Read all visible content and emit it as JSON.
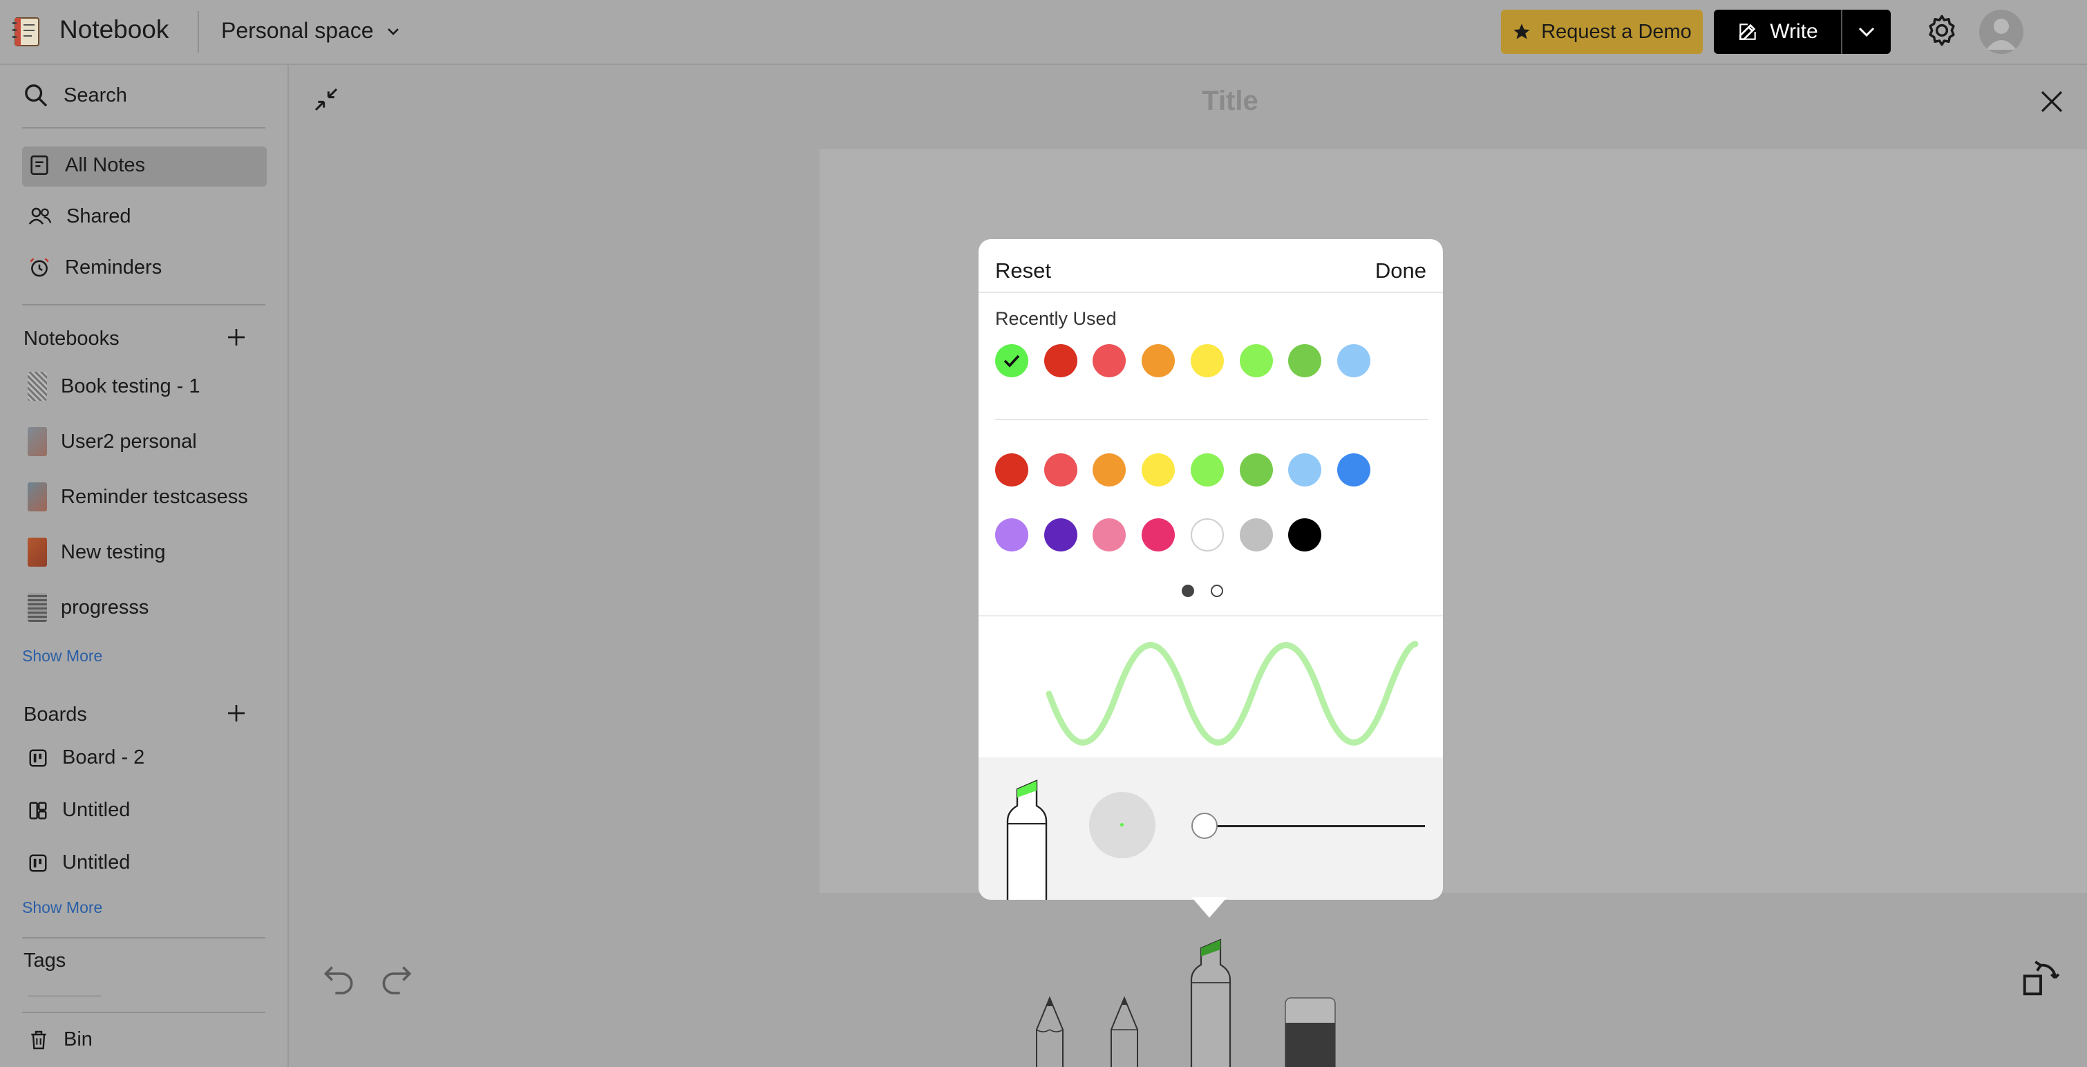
{
  "header": {
    "app_name": "Notebook",
    "space": "Personal space",
    "demo_button": "Request a Demo",
    "write_button": "Write"
  },
  "sidebar": {
    "search": "Search",
    "nav": [
      {
        "label": "All Notes",
        "icon": "notes-icon",
        "active": true
      },
      {
        "label": "Shared",
        "icon": "people-icon"
      },
      {
        "label": "Reminders",
        "icon": "alarm-icon"
      }
    ],
    "notebooks_title": "Notebooks",
    "notebooks": [
      {
        "label": "Book testing - 1"
      },
      {
        "label": "User2 personal"
      },
      {
        "label": "Reminder testcasess"
      },
      {
        "label": "New testing"
      },
      {
        "label": "progresss"
      }
    ],
    "notebooks_more": "Show More",
    "boards_title": "Boards",
    "boards": [
      {
        "label": "Board - 2"
      },
      {
        "label": "Untitled"
      },
      {
        "label": "Untitled"
      }
    ],
    "boards_more": "Show More",
    "tags_title": "Tags",
    "bin": "Bin"
  },
  "editor": {
    "title_placeholder": "Title"
  },
  "color_picker": {
    "reset": "Reset",
    "done": "Done",
    "recent_label": "Recently Used",
    "selected_color": "#5ef04a",
    "recent_colors": [
      "#5ef04a",
      "#d9301f",
      "#ec5256",
      "#f2992e",
      "#fde743",
      "#8af254",
      "#76cc4a",
      "#90c8f8"
    ],
    "palette_row1": [
      "#d9301f",
      "#ec5256",
      "#f2992e",
      "#fde743",
      "#8af254",
      "#76cc4a",
      "#90c8f8",
      "#3c8af0"
    ],
    "palette_row2": [
      "#b07af3",
      "#6026bc",
      "#ef7fa0",
      "#e8306e",
      "#ffffff",
      "#c0c0c0",
      "#000000"
    ],
    "page_count": 2,
    "current_page": 1,
    "preview_stroke": "#b6f0a6",
    "size_level": 0
  }
}
